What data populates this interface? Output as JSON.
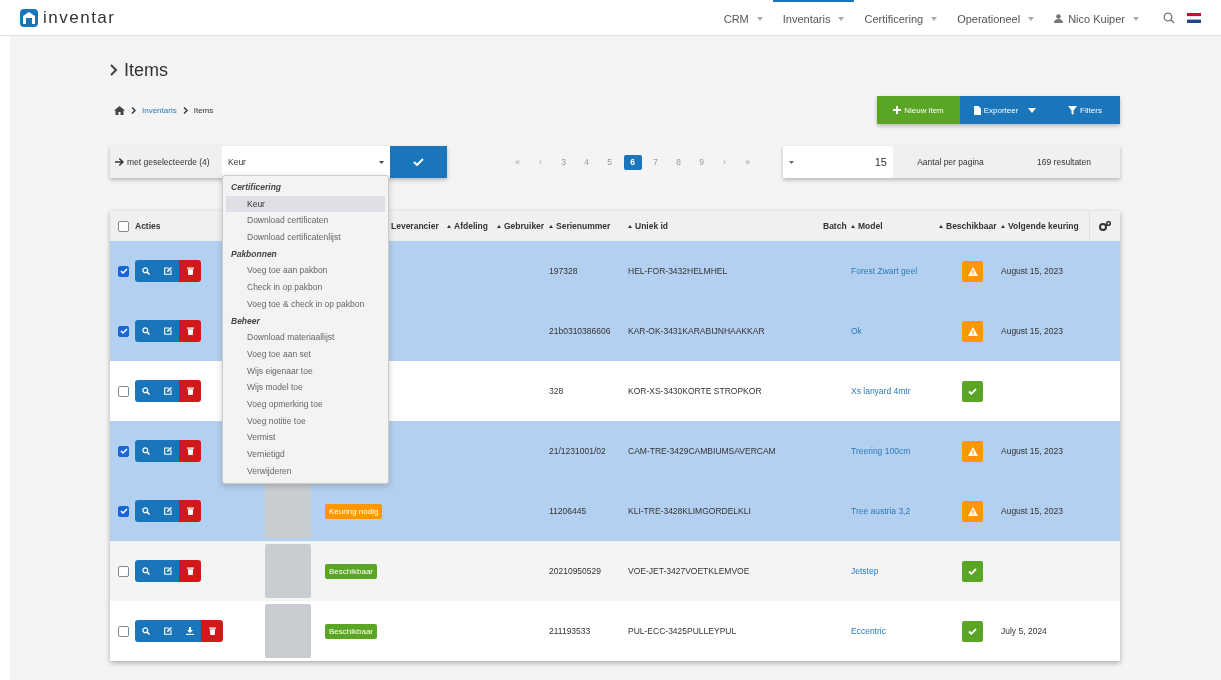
{
  "nav": {
    "logo": "inventar",
    "items": [
      {
        "label": "CRM",
        "selected": false
      },
      {
        "label": "Inventaris",
        "selected": true
      },
      {
        "label": "Certificering",
        "selected": false
      },
      {
        "label": "Operationeel",
        "selected": false
      }
    ],
    "user": "Nico Kuiper"
  },
  "page_title": "Items",
  "breadcrumb": [
    "Inventaris",
    "Items"
  ],
  "actions": [
    {
      "label": "Nieuw item",
      "kind": "new"
    },
    {
      "label": "Exporteer",
      "kind": "export"
    },
    {
      "label": "Filters",
      "kind": "filter"
    }
  ],
  "bulk": {
    "label": "met geselecteerde (4)",
    "value": "Keur",
    "menu": [
      {
        "group": "Certificering",
        "items": [
          {
            "label": "Keur",
            "selected": true
          },
          {
            "label": "Download certificaten",
            "selected": false
          },
          {
            "label": "Download certificatenlijst",
            "selected": false
          }
        ]
      },
      {
        "group": "Pakbonnen",
        "items": [
          {
            "label": "Voeg toe aan pakbon",
            "selected": false
          },
          {
            "label": "Check in op pakbon",
            "selected": false
          },
          {
            "label": "Voeg toe & check in op pakbon",
            "selected": false
          }
        ]
      },
      {
        "group": "Beheer",
        "items": [
          {
            "label": "Download materiaallijst",
            "selected": false
          },
          {
            "label": "Voeg toe aan set",
            "selected": false
          },
          {
            "label": "Wijs eigenaar toe",
            "selected": false
          },
          {
            "label": "Wijs model toe",
            "selected": false
          },
          {
            "label": "Voeg opmerking toe",
            "selected": false
          },
          {
            "label": "Voeg notitie toe",
            "selected": false
          },
          {
            "label": "Vermist",
            "selected": false
          },
          {
            "label": "Vernietigd",
            "selected": false
          },
          {
            "label": "Verwijderen",
            "selected": false
          }
        ]
      }
    ]
  },
  "pagination": [
    {
      "label": "«",
      "selected": false
    },
    {
      "label": "‹",
      "selected": false
    },
    {
      "label": "3",
      "selected": false
    },
    {
      "label": "4",
      "selected": false
    },
    {
      "label": "5",
      "selected": false
    },
    {
      "label": "6",
      "selected": true
    },
    {
      "label": "7",
      "selected": false
    },
    {
      "label": "8",
      "selected": false
    },
    {
      "label": "9",
      "selected": false
    },
    {
      "label": "›",
      "selected": false
    },
    {
      "label": "»",
      "selected": false
    }
  ],
  "per_page": {
    "value": "15",
    "label": "Aantal per pagina",
    "results": "169 resultaten"
  },
  "table": {
    "all_selected": false,
    "columns": [
      {
        "label": "Acties",
        "sortable": false
      },
      {
        "label": "Leverancier",
        "sortable": false
      },
      {
        "label": "Afdeling",
        "sortable": true
      },
      {
        "label": "Gebruiker",
        "sortable": true
      },
      {
        "label": "Serienummer",
        "sortable": true
      },
      {
        "label": "Uniek id",
        "sortable": true
      },
      {
        "label": "Batch",
        "sortable": false
      },
      {
        "label": "Model",
        "sortable": true
      },
      {
        "label": "Beschikbaar",
        "sortable": true
      },
      {
        "label": "Volgende keuring",
        "sortable": true
      }
    ],
    "rows": [
      {
        "selected": true,
        "buttons": [
          {
            "kind": "search"
          },
          {
            "kind": "edit"
          },
          {
            "kind": "delete"
          }
        ],
        "photo": false,
        "serial": "197328",
        "unique_id": "HEL-FOR-3432HELMHEL",
        "model": "Forest Zwart geel",
        "available": false,
        "next_inspection": "August 15, 2023"
      },
      {
        "selected": true,
        "buttons": [
          {
            "kind": "search"
          },
          {
            "kind": "edit"
          },
          {
            "kind": "delete"
          }
        ],
        "photo": false,
        "serial": "21b0310386606",
        "unique_id": "KAR-OK-3431KARABIJNHAAKKAR",
        "model": "Ok",
        "available": false,
        "next_inspection": "August 15, 2023"
      },
      {
        "selected": false,
        "buttons": [
          {
            "kind": "search"
          },
          {
            "kind": "edit"
          },
          {
            "kind": "delete"
          }
        ],
        "photo": false,
        "serial": "328",
        "unique_id": "KOR-XS-3430KORTE STROPKOR",
        "model": "Xs lanyard 4mtr",
        "available": true
      },
      {
        "selected": true,
        "buttons": [
          {
            "kind": "search"
          },
          {
            "kind": "edit"
          },
          {
            "kind": "delete"
          }
        ],
        "photo": false,
        "serial": "21/1231001/02",
        "unique_id": "CAM-TRE-3429CAMBIUMSAVERCAM",
        "model": "Treering 100cm",
        "available": false,
        "next_inspection": "August 15, 2023"
      },
      {
        "selected": true,
        "buttons": [
          {
            "kind": "search"
          },
          {
            "kind": "edit"
          },
          {
            "kind": "delete"
          }
        ],
        "photo": true,
        "status": {
          "label": "Keuring nodig",
          "color": "#ff9800"
        },
        "serial": "11206445",
        "unique_id": "KLI-TRE-3428KLIMGORDELKLI",
        "model": "Tree austria 3,2",
        "available": false,
        "next_inspection": "August 15, 2023"
      },
      {
        "selected": false,
        "buttons": [
          {
            "kind": "search"
          },
          {
            "kind": "edit"
          },
          {
            "kind": "delete"
          }
        ],
        "photo": true,
        "status": {
          "label": "Beschikbaar",
          "color": "#5ba524"
        },
        "serial": "20210950529",
        "unique_id": "VOE-JET-3427VOETKLEMVOE",
        "model": "Jetstep",
        "available": true
      },
      {
        "selected": false,
        "buttons": [
          {
            "kind": "search"
          },
          {
            "kind": "edit"
          },
          {
            "kind": "download"
          },
          {
            "kind": "delete"
          }
        ],
        "photo": true,
        "status": {
          "label": "Beschikbaar",
          "color": "#5ba524"
        },
        "serial": "211193533",
        "unique_id": "PUL-ECC-3425PULLEYPUL",
        "model": "Eccentric",
        "available": true,
        "next_inspection": "July 5, 2024"
      }
    ]
  }
}
